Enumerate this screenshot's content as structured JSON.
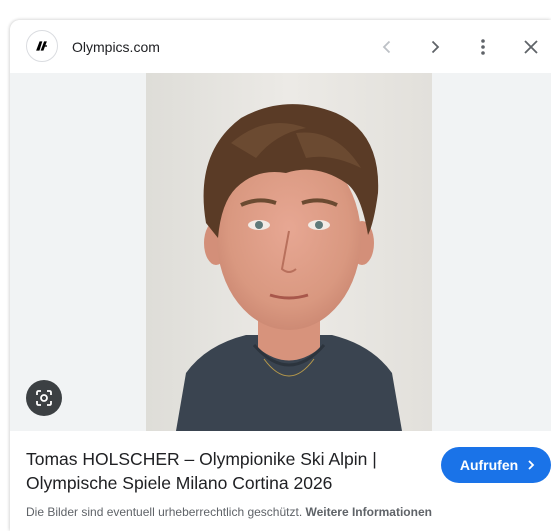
{
  "header": {
    "site_name": "Olympics.com",
    "favicon_icon": "olympics-logo-icon",
    "buttons": {
      "prev_icon": "chevron-left-icon",
      "next_icon": "chevron-right-icon",
      "more_icon": "more-vert-icon",
      "close_icon": "close-icon"
    }
  },
  "image": {
    "lens_icon": "google-lens-icon",
    "subject": "portrait photo"
  },
  "result": {
    "title_line1": "Tomas HOLSCHER – Olympionike Ski Alpin |",
    "title_line2": "Olympische Spiele Milano Cortina 2026",
    "open_button_label": "Aufrufen",
    "open_button_icon": "chevron-right-icon",
    "copyright_note": "Die Bilder sind eventuell urheberrechtlich geschützt.",
    "more_info_link": "Weitere Informationen"
  },
  "colors": {
    "accent": "#1a73e8",
    "disabled_icon": "#bdc1c6",
    "icon": "#5f6368"
  }
}
